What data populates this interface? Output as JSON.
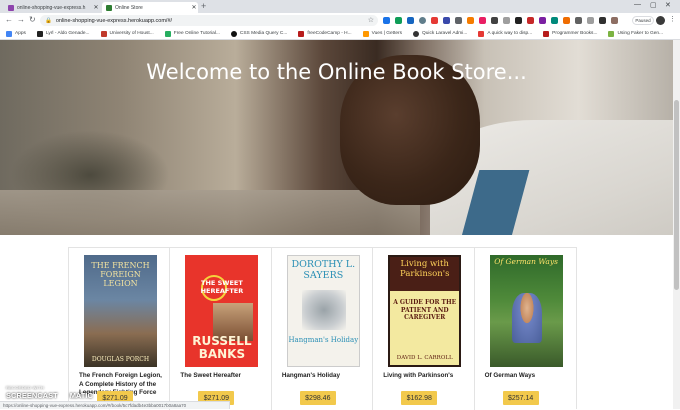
{
  "browser": {
    "tabs": [
      {
        "title": "online-shopping-vue-express.h",
        "favicon_color": "#8e44ad"
      },
      {
        "title": "Online Store",
        "favicon_color": "#2e7d32"
      }
    ],
    "new_tab_icon": "plus-icon",
    "url": "online-shopping-vue-express.herokuapp.com/#/",
    "profile_label": "Paused",
    "bookmarks": [
      {
        "label": "Apps",
        "color": "#4285f4"
      },
      {
        "label": "Lyrl - Aldo Genade...",
        "color": "#222222"
      },
      {
        "label": "University of Houst...",
        "color": "#c0392b"
      },
      {
        "label": "Free Online Tutorial...",
        "color": "#27ae60"
      },
      {
        "label": "CSS Media Query C...",
        "color": "#111111"
      },
      {
        "label": "freeCodeCamp - H...",
        "color": "#b71c1c"
      },
      {
        "label": "Vues | Getters",
        "color": "#ff9800"
      },
      {
        "label": "Quick Laravel Admi...",
        "color": "#333333"
      },
      {
        "label": "A quick way to disp...",
        "color": "#e53935"
      },
      {
        "label": "Programmer Books...",
        "color": "#b71c1c"
      },
      {
        "label": "Using Faker to Gen...",
        "color": "#7cb342"
      }
    ],
    "status_url": "https://online-shopping-vue-express.herokuapp.com/#/book/5c7fdadb4e3bba0017b0a8aa70"
  },
  "hero": {
    "title": "Welcome to the Online Book Store..."
  },
  "books": [
    {
      "title": "The French Foreign Legion, A Complete History of the Legendary Fighting Force",
      "price": "$271.09",
      "cover": {
        "title_text": "THE FRENCH FOREIGN LEGION",
        "author_text": "DOUGLAS PORCH"
      }
    },
    {
      "title": "The Sweet Hereafter",
      "price": "$271.09",
      "cover": {
        "title_text": "THE SWEET HEREAFTER",
        "author_text": "RUSSELL BANKS"
      }
    },
    {
      "title": "Hangman's Holiday",
      "price": "$298.46",
      "cover": {
        "title_text": "Hangman's Holiday",
        "author_text": "DOROTHY L. SAYERS"
      }
    },
    {
      "title": "Living with Parkinson's",
      "price": "$162.98",
      "cover": {
        "title_text": "Living with Parkinson's",
        "subtitle_text": "A GUIDE FOR THE PATIENT AND CAREGIVER",
        "author_text": "DAVID L. CARROLL"
      }
    },
    {
      "title": "Of German Ways",
      "price": "$257.14",
      "cover": {
        "title_text": "Of German Ways"
      }
    }
  ],
  "watermark": {
    "line1": "RECORDED WITH",
    "line2_a": "SCREENCAST",
    "line2_b": "MATIC"
  }
}
